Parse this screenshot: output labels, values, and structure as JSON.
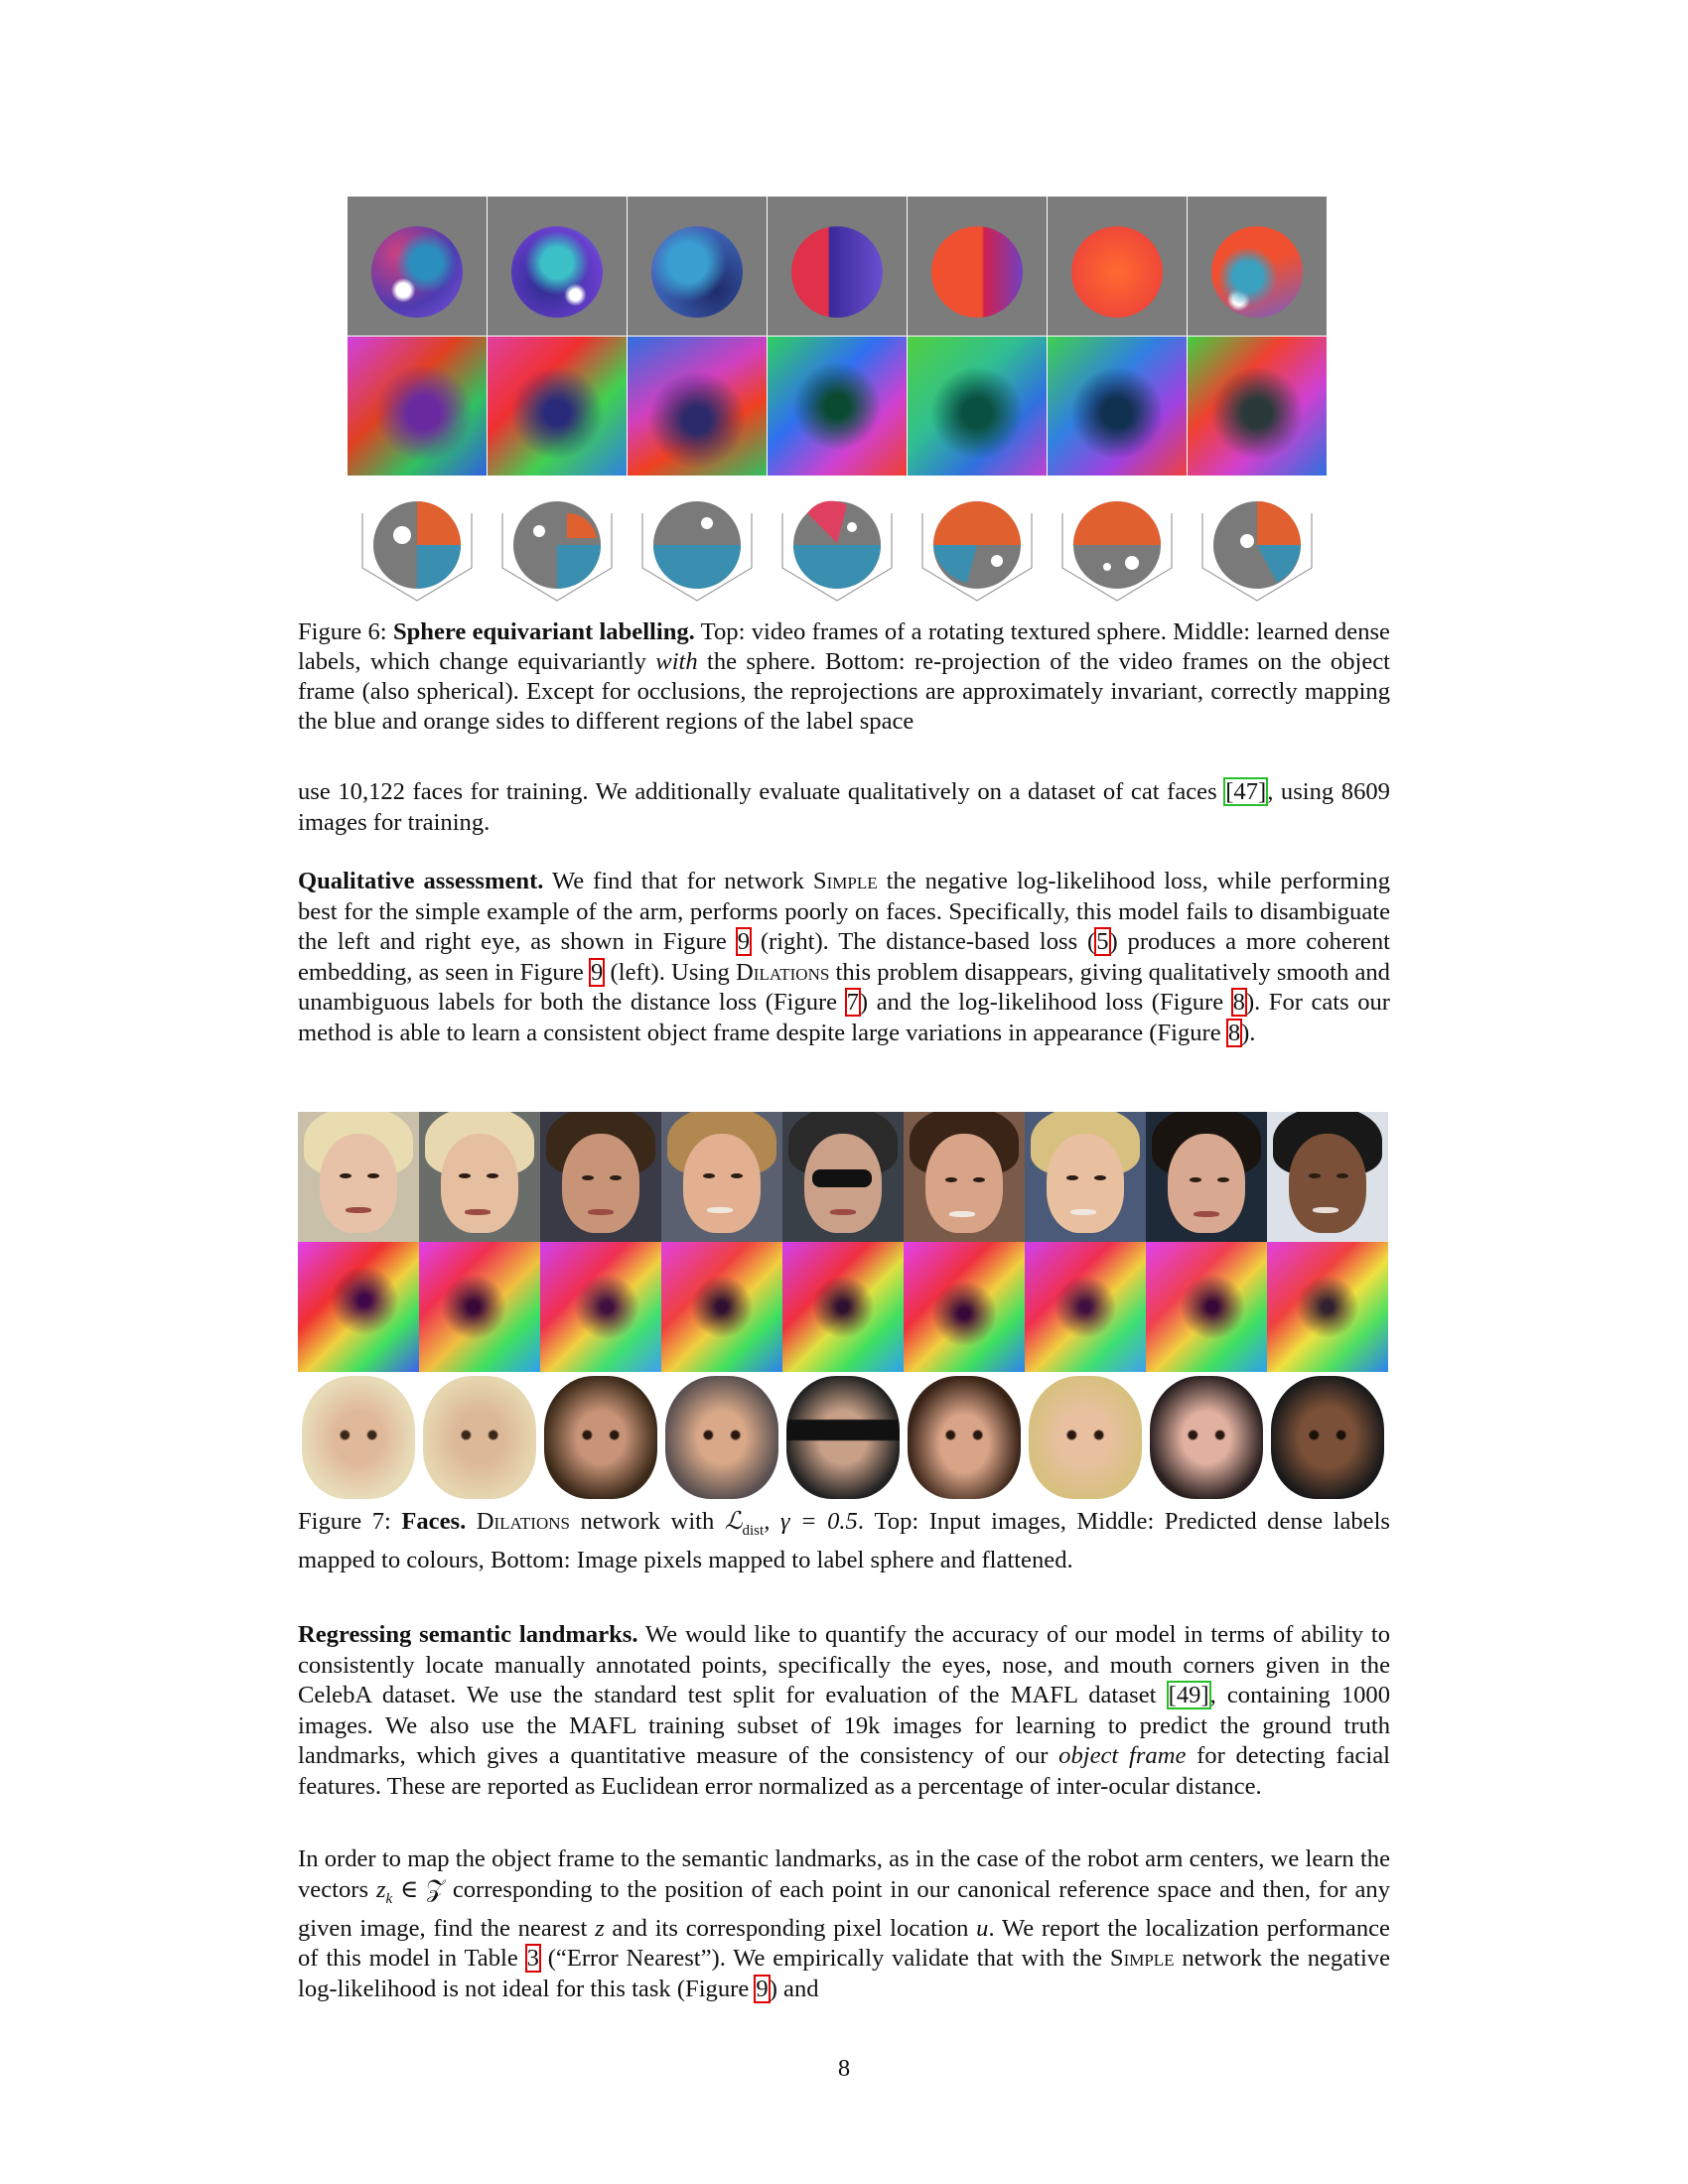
{
  "figure6": {
    "label": "Figure 6:",
    "title": "Sphere equivariant labelling.",
    "caption_a": " Top: video frames of a rotating textured sphere. Middle: learned dense labels, which change equivariantly ",
    "caption_em": "with",
    "caption_b": " the sphere. Bottom: re-projection of the video frames on the object frame (also spherical). Except for occlusions, the reprojections are approximately invariant, correctly mapping the blue and orange sides to different regions of the label space"
  },
  "para1": {
    "text_a": "use 10,122 faces for training. We additionally evaluate qualitatively on a dataset of cat faces ",
    "cite": "[47]",
    "text_b": ", using 8609 images for training."
  },
  "para2": {
    "heading": "Qualitative assessment.",
    "t1": " We find that for network ",
    "simple": "Simple",
    "t2": " the negative log-likelihood loss, while performing best for the simple example of the arm, performs poorly on faces. Specifically, this model fails to disambiguate the left and right eye, as shown in Figure ",
    "r1": "9",
    "t3": " (right). The distance-based loss (",
    "r2": "5",
    "t4": ") produces a more coherent embedding, as seen in Figure ",
    "r3": "9",
    "t5": " (left). Using ",
    "dilations": "Dilations",
    "t6": " this problem disappears, giving qualitatively smooth and unambiguous labels for both the distance loss (Figure ",
    "r4": "7",
    "t7": ") and the log-likelihood loss (Figure ",
    "r5": "8",
    "t8": "). For cats our method is able to learn a consistent object frame despite large variations in appearance (Figure ",
    "r6": "8",
    "t9": ")."
  },
  "figure7": {
    "label": "Figure 7:",
    "title": "Faces.",
    "dilations": "Dilations",
    "t1": " network with ",
    "math": "ℒ",
    "math_sub": "dist",
    "math_tail": ", γ = 0.5",
    "t2": ". Top: Input images, Middle: Predicted dense labels mapped to colours, Bottom: Image pixels mapped to label sphere and flattened."
  },
  "para3": {
    "heading": "Regressing semantic landmarks.",
    "t1": " We would like to quantify the accuracy of our model in terms of ability to consistently locate manually annotated points, specifically the eyes, nose, and mouth corners given in the CelebA dataset. We use the standard test split for evaluation of the MAFL dataset ",
    "cite": "[49]",
    "t2": ", containing 1000 images. We also use the MAFL training subset of 19k images for learning to predict the ground truth landmarks, which gives a quantitative measure of the consistency of our ",
    "em": "object frame",
    "t3": " for detecting facial features. These are reported as Euclidean error normalized as a percentage of inter-ocular distance."
  },
  "para4": {
    "t1": "In order to map the object frame to the semantic landmarks, as in the case of the robot arm centers, we learn the vectors ",
    "m1": "z",
    "m1sub": "k",
    "m1tail": " ∈ 𝒵",
    "t2": " corresponding to the position of each point in our canonical reference space and then, for any given image, find the nearest ",
    "m2": "z",
    "t3": " and its corresponding pixel location ",
    "m3": "u",
    "t4": ". We report the localization performance of this model in Table ",
    "r1": "3",
    "t5": " (“Error Nearest”). We empirically validate that with the ",
    "simple": "Simple",
    "t6": " network the negative log-likelihood is not ideal for this task (Figure ",
    "r2": "9",
    "t7": ") and"
  },
  "page_number": "8",
  "colors": {
    "ref_box": "#e00000",
    "cite_box": "#27c027"
  }
}
